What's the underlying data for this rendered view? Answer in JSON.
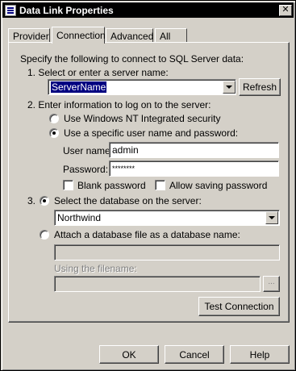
{
  "window": {
    "title": "Data Link Properties",
    "close_glyph": "✕"
  },
  "tabs": [
    {
      "label": "Provider",
      "active": false
    },
    {
      "label": "Connection",
      "active": true
    },
    {
      "label": "Advanced",
      "active": false
    },
    {
      "label": "All",
      "active": false
    }
  ],
  "connection": {
    "intro": "Specify the following to connect to SQL Server data:",
    "step1_label": "1. Select or enter a server name:",
    "server_name_value": "ServerName",
    "refresh_label": "Refresh",
    "step2_label": "2. Enter information to log on to the server:",
    "radio_nt_security": "Use Windows NT Integrated security",
    "radio_specific_user": "Use a specific user name and password:",
    "logon_mode": "specific_user",
    "username_label": "User name:",
    "username_value": "admin",
    "password_label": "Password:",
    "password_value": "********",
    "blank_password_label": "Blank password",
    "blank_password_checked": false,
    "allow_saving_label": "Allow saving password",
    "allow_saving_checked": false,
    "step3_number": "3.",
    "radio_select_db": "Select the database on the server:",
    "database_mode": "select",
    "database_value": "Northwind",
    "radio_attach_db": "Attach a database file as a database name:",
    "attach_db_value": "",
    "using_filename_label": "Using the filename:",
    "filename_value": "",
    "browse_label": "...",
    "test_connection_label": "Test Connection"
  },
  "footer": {
    "ok_label": "OK",
    "cancel_label": "Cancel",
    "help_label": "Help"
  }
}
